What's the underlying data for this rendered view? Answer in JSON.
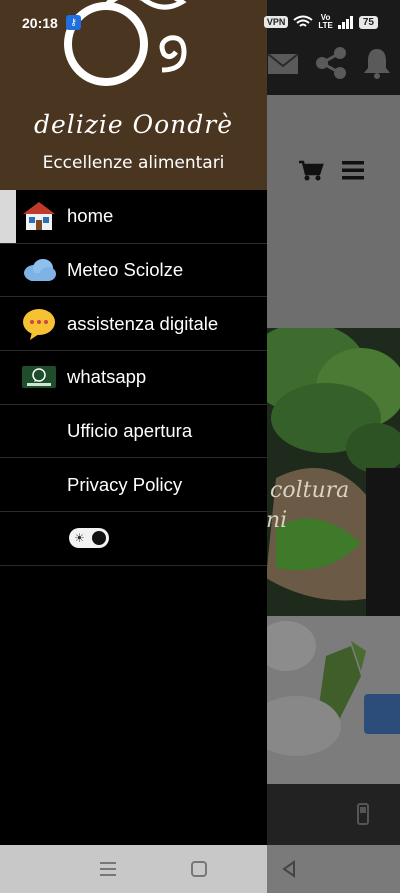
{
  "status_bar": {
    "time": "20:18",
    "vpn_badge": "VPN",
    "volte_top": "Vo",
    "volte_bottom": "LTE",
    "battery": "75"
  },
  "drawer": {
    "brand_name": "delizie Oondrè",
    "tagline": "Eccellenze alimentari",
    "menu": [
      {
        "label": "home",
        "icon": "house-icon",
        "active": true
      },
      {
        "label": "Meteo Sciolze",
        "icon": "cloud-icon",
        "active": false
      },
      {
        "label": "assistenza digitale",
        "icon": "chat-bubble-icon",
        "active": false
      },
      {
        "label": "whatsapp",
        "icon": "whatsapp-icon",
        "active": false
      },
      {
        "label": "Ufficio apertura",
        "icon": "",
        "active": false
      },
      {
        "label": "Privacy Policy",
        "icon": "",
        "active": false
      }
    ],
    "theme_toggle": "theme-toggle"
  },
  "background_app": {
    "banner_text_1": "coltura",
    "banner_text_2": "ni"
  },
  "colors": {
    "drawer_header_bg": "#4a3520",
    "drawer_bg": "#000000",
    "active_indicator": "#d9d9d9",
    "nav_bar_bg": "#c8c8c8"
  }
}
